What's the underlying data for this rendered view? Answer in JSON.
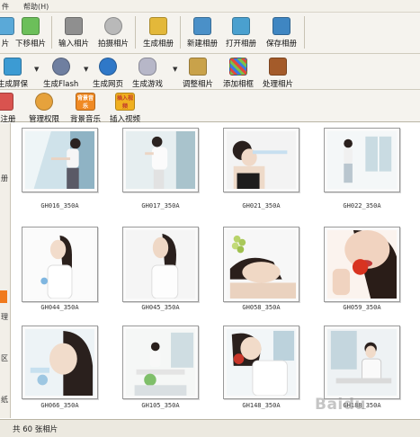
{
  "menubar": {
    "items": [
      "件",
      "帮助(H)"
    ]
  },
  "toolbar1": {
    "buttons": [
      {
        "label": "片",
        "icon": "folder-photo-icon",
        "color": "#5aa9d8"
      },
      {
        "label": "下移相片",
        "icon": "move-down-photo-icon",
        "color": "#6cbf5a"
      },
      {
        "label": "输入相片",
        "icon": "import-photo-icon",
        "color": "#8f8f8f"
      },
      {
        "label": "拍摄相片",
        "icon": "camera-icon",
        "color": "#b9b9b9"
      },
      {
        "label": "生成相册",
        "icon": "create-album-icon",
        "color": "#e3b83a"
      },
      {
        "label": "新建相册",
        "icon": "new-album-icon",
        "color": "#4a90c8"
      },
      {
        "label": "打开相册",
        "icon": "open-album-icon",
        "color": "#4aa0cf"
      },
      {
        "label": "保存相册",
        "icon": "save-album-icon",
        "color": "#3f86c2"
      }
    ]
  },
  "toolbar2": {
    "buttons": [
      {
        "label": "生成屏保",
        "icon": "screensaver-icon",
        "color": "#3c9bd3"
      },
      {
        "label": "生成Flash",
        "icon": "flash-icon",
        "color": "#6f7fa0"
      },
      {
        "label": "生成网页",
        "icon": "ie-browser-icon",
        "color": "#2f78c8"
      },
      {
        "label": "生成游戏",
        "icon": "gamepad-icon",
        "color": "#b7b7c8"
      },
      {
        "label": "调整相片",
        "icon": "adjust-photo-icon",
        "color": "#c9a24a"
      },
      {
        "label": "添加相框",
        "icon": "photo-frame-icon",
        "color": "#7bc24a"
      },
      {
        "label": "处理相片",
        "icon": "process-photo-icon",
        "color": "#a45b2a"
      }
    ]
  },
  "toolbar3": {
    "buttons": [
      {
        "label": "户注册",
        "icon": "register-icon",
        "color": "#d9534f"
      },
      {
        "label": "管理权限",
        "icon": "permissions-icon",
        "color": "#e6a23c"
      },
      {
        "label": "背景音乐",
        "icon": "background-music-icon",
        "color": "#f08a24"
      },
      {
        "label": "插入视频",
        "icon": "insert-video-icon",
        "color": "#f0b020"
      }
    ],
    "music_icon_text": "背景音乐",
    "video_icon_text": "插入视频"
  },
  "leftstrip": {
    "labels": [
      "册",
      "理",
      "区",
      "纸"
    ]
  },
  "photos": [
    {
      "name": "GH016_350A"
    },
    {
      "name": "GH017_350A"
    },
    {
      "name": "GH021_350A"
    },
    {
      "name": "GH022_350A"
    },
    {
      "name": "GH044_350A"
    },
    {
      "name": "GH045_350A"
    },
    {
      "name": "GH058_350A"
    },
    {
      "name": "GH059_350A"
    },
    {
      "name": "GH066_350A"
    },
    {
      "name": "GH105_350A"
    },
    {
      "name": "GH148_350A"
    },
    {
      "name": "GH188_350A"
    }
  ],
  "status": {
    "text": "共 60 张相片"
  },
  "watermark": {
    "text": "Baidu"
  }
}
